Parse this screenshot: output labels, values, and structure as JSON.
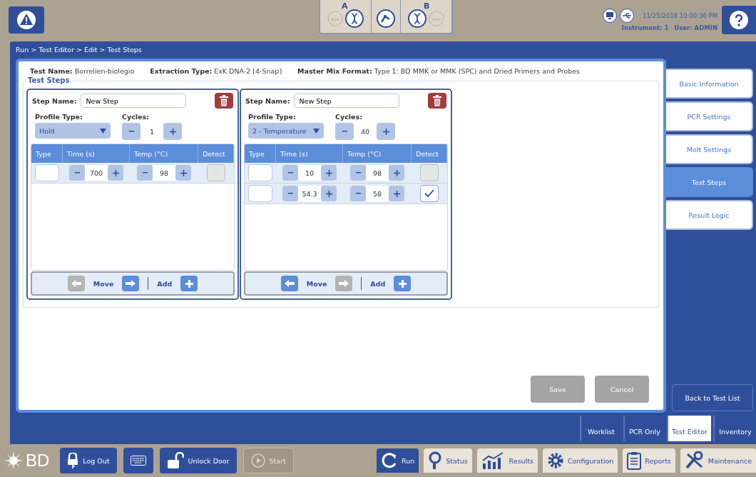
{
  "header": {
    "bay_a": "A",
    "bay_b": "B",
    "datetime": "11/25/2018 10:00:36 PM",
    "instrument": "Instrument: 1",
    "user": "User: ADMIN"
  },
  "breadcrumb": "Run > Test Editor > Edit > Test Steps",
  "test_info": [
    {
      "label": "Test Name:",
      "value": "Borrelien-biolegio"
    },
    {
      "label": "Extraction Type:",
      "value": "ExK DNA-2 [4-Snap]"
    },
    {
      "label": "Master Mix Format:",
      "value": "Type 1:  BD MMK or MMK (SPC) and Dried Primers and Probes"
    }
  ],
  "section_title": "Test Steps",
  "steps": [
    {
      "step_name_label": "Step Name:",
      "step_name": "New Step",
      "profile_type_label": "Profile Type:",
      "profile_type": "Hold",
      "cycles_label": "Cycles:",
      "cycles": "1",
      "columns": [
        "Type",
        "Time (s)",
        "Temp (°C)",
        "Detect"
      ],
      "rows": [
        {
          "time": "700",
          "temp": "98",
          "detect": false
        }
      ],
      "move_left_disabled": true,
      "move_right_disabled": false,
      "move_label": "Move",
      "add_label": "Add"
    },
    {
      "step_name_label": "Step Name:",
      "step_name": "New Step",
      "profile_type_label": "Profile Type:",
      "profile_type": "2 - Temperature",
      "cycles_label": "Cycles:",
      "cycles": "40",
      "columns": [
        "Type",
        "Time (s)",
        "Temp (°C)",
        "Detect"
      ],
      "rows": [
        {
          "time": "10",
          "temp": "98",
          "detect": false
        },
        {
          "time": "54.3",
          "temp": "58",
          "detect": true
        }
      ],
      "move_left_disabled": false,
      "move_right_disabled": true,
      "move_label": "Move",
      "add_label": "Add"
    }
  ],
  "actions": [
    {
      "label": "Save",
      "disabled": true
    },
    {
      "label": "Cancel",
      "disabled": true
    }
  ],
  "side_tabs": [
    {
      "label": "Basic Information",
      "selected": false
    },
    {
      "label": "PCR Settings",
      "selected": false
    },
    {
      "label": "Melt Settings",
      "selected": false
    },
    {
      "label": "Test Steps",
      "selected": true
    },
    {
      "label": "Result Logic",
      "selected": false
    }
  ],
  "back_button": "Back to Test List",
  "bottom_tabs": [
    {
      "label": "Worklist",
      "selected": false
    },
    {
      "label": "PCR Only",
      "selected": false
    },
    {
      "label": "Test Editor",
      "selected": true
    },
    {
      "label": "Inventory",
      "selected": false
    }
  ],
  "footer": {
    "logo": "BD",
    "buttons": [
      {
        "kind": "logout",
        "label": "Log Out",
        "disabled": false
      },
      {
        "kind": "keyboard",
        "disabled": false
      },
      {
        "kind": "unlock",
        "label": "Unlock Door",
        "disabled": false
      },
      {
        "kind": "start",
        "label": "Start",
        "disabled": true
      }
    ],
    "nav": [
      {
        "kind": "run",
        "label": "Run",
        "selected": true
      },
      {
        "kind": "status",
        "label": "Status",
        "selected": false
      },
      {
        "kind": "results",
        "label": "Results",
        "selected": false
      },
      {
        "kind": "configuration",
        "label": "Configuration",
        "selected": false
      },
      {
        "kind": "reports",
        "label": "Reports",
        "selected": false
      },
      {
        "kind": "maintenance",
        "label": "Maintenance",
        "selected": false
      }
    ]
  }
}
